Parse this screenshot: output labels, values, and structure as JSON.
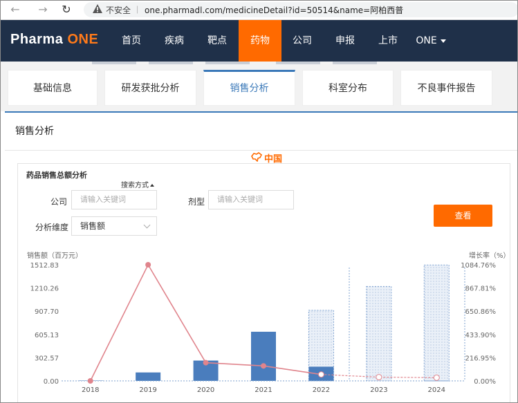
{
  "browser": {
    "security_label": "不安全",
    "separator": "|",
    "url": "one.pharmadl.com/medicineDetail?id=50514&name=阿柏西普"
  },
  "nav": {
    "logo_main": "Pharma ",
    "logo_accent": "ONE",
    "items": [
      {
        "label": "首页"
      },
      {
        "label": "疾病"
      },
      {
        "label": "靶点"
      },
      {
        "label": "药物"
      },
      {
        "label": "公司"
      },
      {
        "label": "申报"
      },
      {
        "label": "上市"
      },
      {
        "label": "ONE"
      }
    ],
    "active_index": 3
  },
  "tabs": [
    {
      "label": "基础信息"
    },
    {
      "label": "研发获批分析"
    },
    {
      "label": "销售分析"
    },
    {
      "label": "科室分布"
    },
    {
      "label": "不良事件报告"
    }
  ],
  "section_title": "销售分析",
  "region_link": "中国",
  "panel": {
    "title": "药品销售总额分析",
    "search_mode": "搜索方式"
  },
  "filters": {
    "company_label": "公司",
    "company_placeholder": "请输入关键词",
    "dosage_label": "剂型",
    "dosage_placeholder": "请输入关键词",
    "dimension_label": "分析维度",
    "dimension_value": "销售额",
    "query_button": "查看"
  },
  "colors": {
    "nav_bg": "#1f3049",
    "accent": "#ff6a00",
    "bar": "#4a7dbd",
    "line": "#e0848c"
  },
  "chart_data": {
    "type": "bar",
    "categories": [
      "2018",
      "2019",
      "2020",
      "2021",
      "2022",
      "2023",
      "2024"
    ],
    "left_axis_title": "销售额（百万元）",
    "right_axis_title": "增长率（%）",
    "left_ticks": [
      "1512.83",
      "1210.26",
      "907.70",
      "605.13",
      "302.57",
      "0.00"
    ],
    "right_ticks": [
      "1084.76%",
      "867.81%",
      "650.86%",
      "433.90%",
      "216.95%",
      "0.00%"
    ],
    "ylim": [
      0,
      1512.83
    ],
    "y2lim": [
      0,
      1084.76
    ],
    "sales": [
      5,
      110,
      265,
      640,
      185,
      null,
      null
    ],
    "forecast_sales": [
      null,
      null,
      null,
      null,
      920,
      1230,
      1510
    ],
    "growth_rate": [
      0,
      1084.76,
      170,
      140,
      60,
      35,
      30
    ],
    "growth_forecast_from_index": 4
  }
}
